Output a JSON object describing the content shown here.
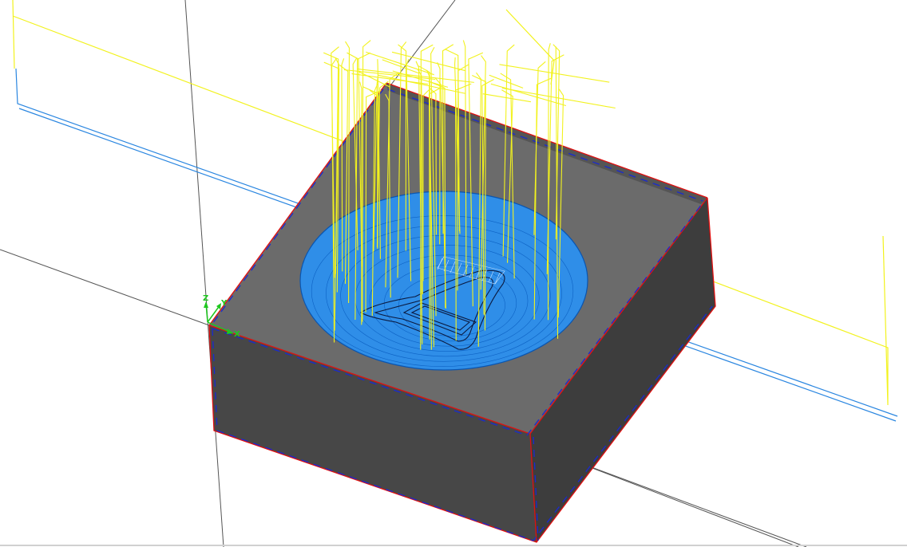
{
  "viewport": {
    "triad": {
      "x_label": "X",
      "y_label": "Y",
      "z_label": "Z"
    }
  },
  "colors": {
    "background": "#ffffff",
    "stock_top": "#6b6b6b",
    "stock_front": "#474747",
    "stock_side": "#3d3d3d",
    "edge_red": "#e01010",
    "edge_blue": "#1a2ad0",
    "pocket_fill": "#2f8ee8",
    "pocket_edge": "#0a55b0",
    "toolpath": "#f2f21e",
    "boundary_blue": "#2a86e0",
    "grid_line": "#555555",
    "triad_green": "#1ec81e"
  },
  "icons": {
    "triad": "xyz-axis-triad-icon"
  }
}
